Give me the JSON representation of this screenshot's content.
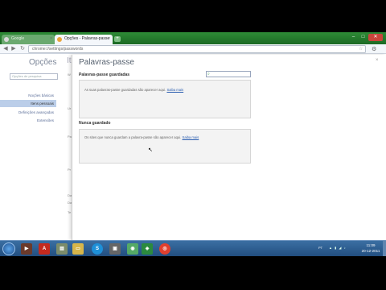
{
  "browser": {
    "tabs": [
      {
        "label": "Google",
        "active": false
      },
      {
        "label": "Opções - Palavras-passe",
        "active": true
      }
    ],
    "new_tab_label": "+",
    "url": "chrome://settings/passwords",
    "window_controls": {
      "minimize": "–",
      "maximize": "□",
      "close": "✕"
    }
  },
  "sidebar": {
    "title": "Opções",
    "search_placeholder": "Opções de pesquisa",
    "items": [
      {
        "label": "Noções básicas",
        "selected": false
      },
      {
        "label": "Itens pessoais",
        "selected": true
      },
      {
        "label": "Definições avançadas",
        "selected": false
      },
      {
        "label": "Extensões",
        "selected": false
      }
    ]
  },
  "background_page": {
    "heading": "It",
    "labels": [
      "W",
      "Ur",
      "Pa",
      "Pr ex",
      "Da",
      "Da pr",
      "Te"
    ]
  },
  "passwords_panel": {
    "title": "Palavras-passe",
    "close": "×",
    "saved_section": {
      "title": "Palavras-passe guardadas",
      "message": "As suas palavras-passe guardadas são aparecer aqui.",
      "link": "Saiba mais"
    },
    "never_section": {
      "title": "Nunca guardado",
      "message": "Os sites que nunca guardam a palavra-passe são aparecer aqui.",
      "link": "Saiba mais"
    }
  },
  "taskbar": {
    "language": "PT",
    "time": "11:09",
    "date": "20-12-2011",
    "accent": "#2b5b8f"
  }
}
